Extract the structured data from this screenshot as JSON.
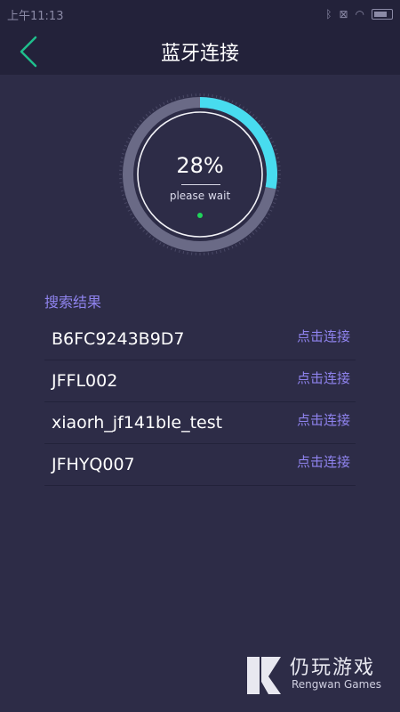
{
  "status_bar": {
    "time": "上午11:13",
    "icons": [
      "bluetooth-icon",
      "sim-off-icon",
      "wifi-icon",
      "battery-icon"
    ]
  },
  "header": {
    "title": "蓝牙连接"
  },
  "progress": {
    "percent_text": "28%",
    "percent_value": 28,
    "status_text": "please wait"
  },
  "results": {
    "title": "搜索结果",
    "devices": [
      {
        "name": "B6FC9243B9D7",
        "action": "点击连接"
      },
      {
        "name": "JFFL002",
        "action": "点击连接"
      },
      {
        "name": "xiaorh_jf141ble_test",
        "action": "点击连接"
      },
      {
        "name": "JFHYQ007",
        "action": "点击连接"
      }
    ]
  },
  "watermark": {
    "cn": "仍玩游戏",
    "en": "Rengwan Games"
  },
  "colors": {
    "background": "#2d2c47",
    "bar": "#23223a",
    "accent": "#8f83ee",
    "progress": "#48dcef",
    "back_arrow": "#1fbf8c",
    "dot": "#1fd45a"
  }
}
